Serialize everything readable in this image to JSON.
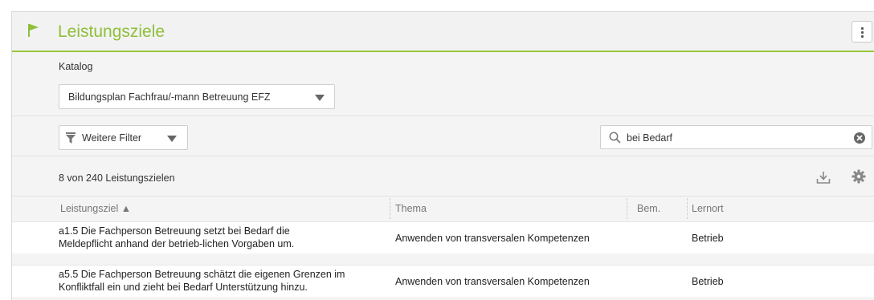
{
  "header": {
    "title": "Leistungsziele",
    "flag_color": "#8fbf3a",
    "icon": "flag-icon",
    "menu_icon": "vertical-dots-icon"
  },
  "katalog": {
    "label": "Katalog",
    "selected": "Bildungsplan Fachfrau/-mann Betreuung EFZ"
  },
  "filter": {
    "label": "Weitere Filter",
    "icon": "filter-icon"
  },
  "search": {
    "value": "bei Bedarf",
    "placeholder": ""
  },
  "results": {
    "count_text": "8 von 240 Leistungszielen"
  },
  "table": {
    "columns": [
      {
        "label": "Leistungsziel ▲"
      },
      {
        "label": "Thema"
      },
      {
        "label": "Bem."
      },
      {
        "label": "Lernort"
      }
    ],
    "rows": [
      {
        "ziel_line1": "a1.5 Die Fachperson Betreuung setzt bei Bedarf die",
        "ziel_line2": "Meldepflicht anhand der betrieb-lichen Vorgaben um.",
        "thema": "Anwenden von transversalen Kompetenzen",
        "bem": "",
        "lernort": "Betrieb"
      },
      {
        "ziel_line1": "a5.5 Die Fachperson Betreuung schätzt die eigenen Grenzen im",
        "ziel_line2": "Konfliktfall ein und zieht bei Bedarf Unterstützung hinzu.",
        "thema": "Anwenden von transversalen Kompetenzen",
        "bem": "",
        "lernort": "Betrieb"
      }
    ]
  }
}
